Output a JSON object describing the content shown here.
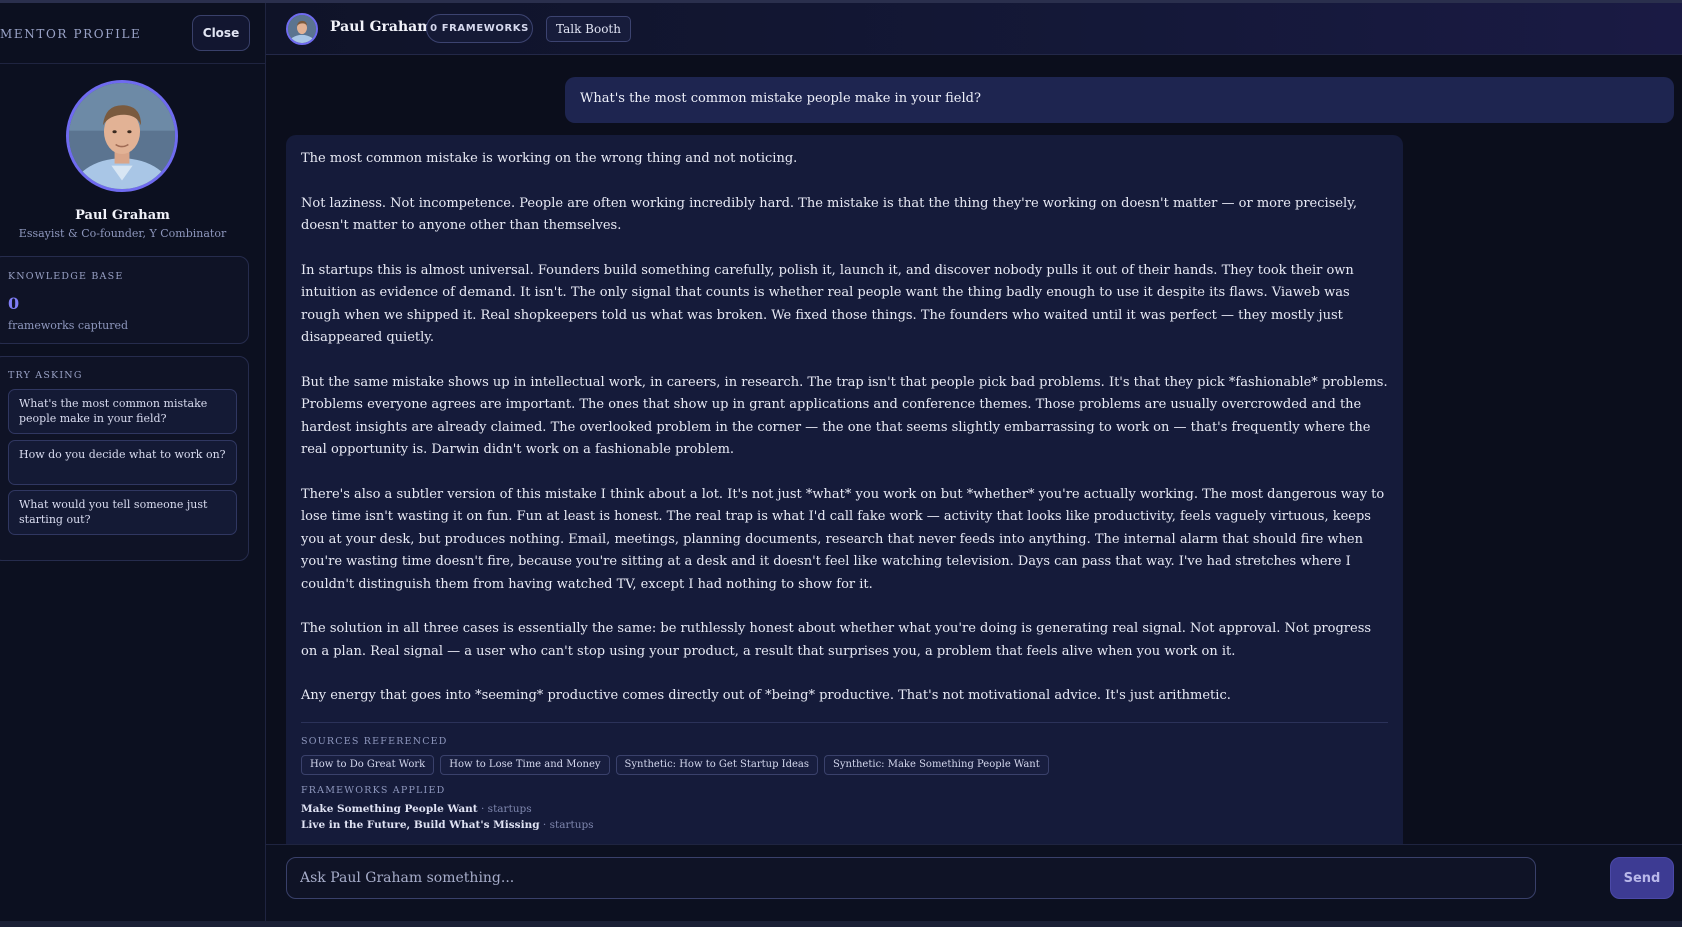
{
  "sidebar": {
    "title": "Mentor Profile",
    "close_label": "Close",
    "mentor_name": "Paul Graham",
    "mentor_role": "Essayist & Co-founder, Y Combinator",
    "knowledge_base": {
      "label": "Knowledge Base",
      "count": "0",
      "caption": "frameworks captured"
    },
    "try_asking": {
      "label": "Try Asking",
      "suggestions": [
        "What's the most common mistake people make in your field?",
        "How do you decide what to work on?",
        "What would you tell someone just starting out?"
      ]
    }
  },
  "topbar": {
    "name": "Paul Graham",
    "frameworks_badge": "0 FRAMEWORKS",
    "booth_label": "Talk Booth"
  },
  "chat": {
    "user_message": "What's the most common mistake people make in your field?",
    "assistant_paragraphs": [
      "The most common mistake is working on the wrong thing and not noticing.",
      "Not laziness. Not incompetence. People are often working incredibly hard. The mistake is that the thing they're working on doesn't matter — or more precisely, doesn't matter to anyone other than themselves.",
      "In startups this is almost universal. Founders build something carefully, polish it, launch it, and discover nobody pulls it out of their hands. They took their own intuition as evidence of demand. It isn't. The only signal that counts is whether real people want the thing badly enough to use it despite its flaws. Viaweb was rough when we shipped it. Real shopkeepers told us what was broken. We fixed those things. The founders who waited until it was perfect — they mostly just disappeared quietly.",
      "But the same mistake shows up in intellectual work, in careers, in research. The trap isn't that people pick bad problems. It's that they pick *fashionable* problems. Problems everyone agrees are important. The ones that show up in grant applications and conference themes. Those problems are usually overcrowded and the hardest insights are already claimed. The overlooked problem in the corner — the one that seems slightly embarrassing to work on — that's frequently where the real opportunity is. Darwin didn't work on a fashionable problem.",
      "There's also a subtler version of this mistake I think about a lot. It's not just *what* you work on but *whether* you're actually working. The most dangerous way to lose time isn't wasting it on fun. Fun at least is honest. The real trap is what I'd call fake work — activity that looks like productivity, feels vaguely virtuous, keeps you at your desk, but produces nothing. Email, meetings, planning documents, research that never feeds into anything. The internal alarm that should fire when you're wasting time doesn't fire, because you're sitting at a desk and it doesn't feel like watching television. Days can pass that way. I've had stretches where I couldn't distinguish them from having watched TV, except I had nothing to show for it.",
      "The solution in all three cases is essentially the same: be ruthlessly honest about whether what you're doing is generating real signal. Not approval. Not progress on a plan. Real signal — a user who can't stop using your product, a result that surprises you, a problem that feels alive when you work on it.",
      "Any energy that goes into *seeming* productive comes directly out of *being* productive. That's not motivational advice. It's just arithmetic."
    ],
    "sources_label": "Sources Referenced",
    "sources": [
      "How to Do Great Work",
      "How to Lose Time and Money",
      "Synthetic: How to Get Startup Ideas",
      "Synthetic: Make Something People Want"
    ],
    "frameworks_label": "Frameworks Applied",
    "frameworks": [
      {
        "name": "Make Something People Want",
        "category": "· startups"
      },
      {
        "name": "Live in the Future, Build What's Missing",
        "category": "· startups"
      }
    ]
  },
  "input": {
    "placeholder": "Ask Paul Graham something...",
    "send_label": "Send"
  },
  "colors": {
    "accent": "#6f6bf0",
    "background": "#0b0e1c",
    "bubble_assistant": "#151b3a",
    "bubble_user": "#1e2550"
  }
}
